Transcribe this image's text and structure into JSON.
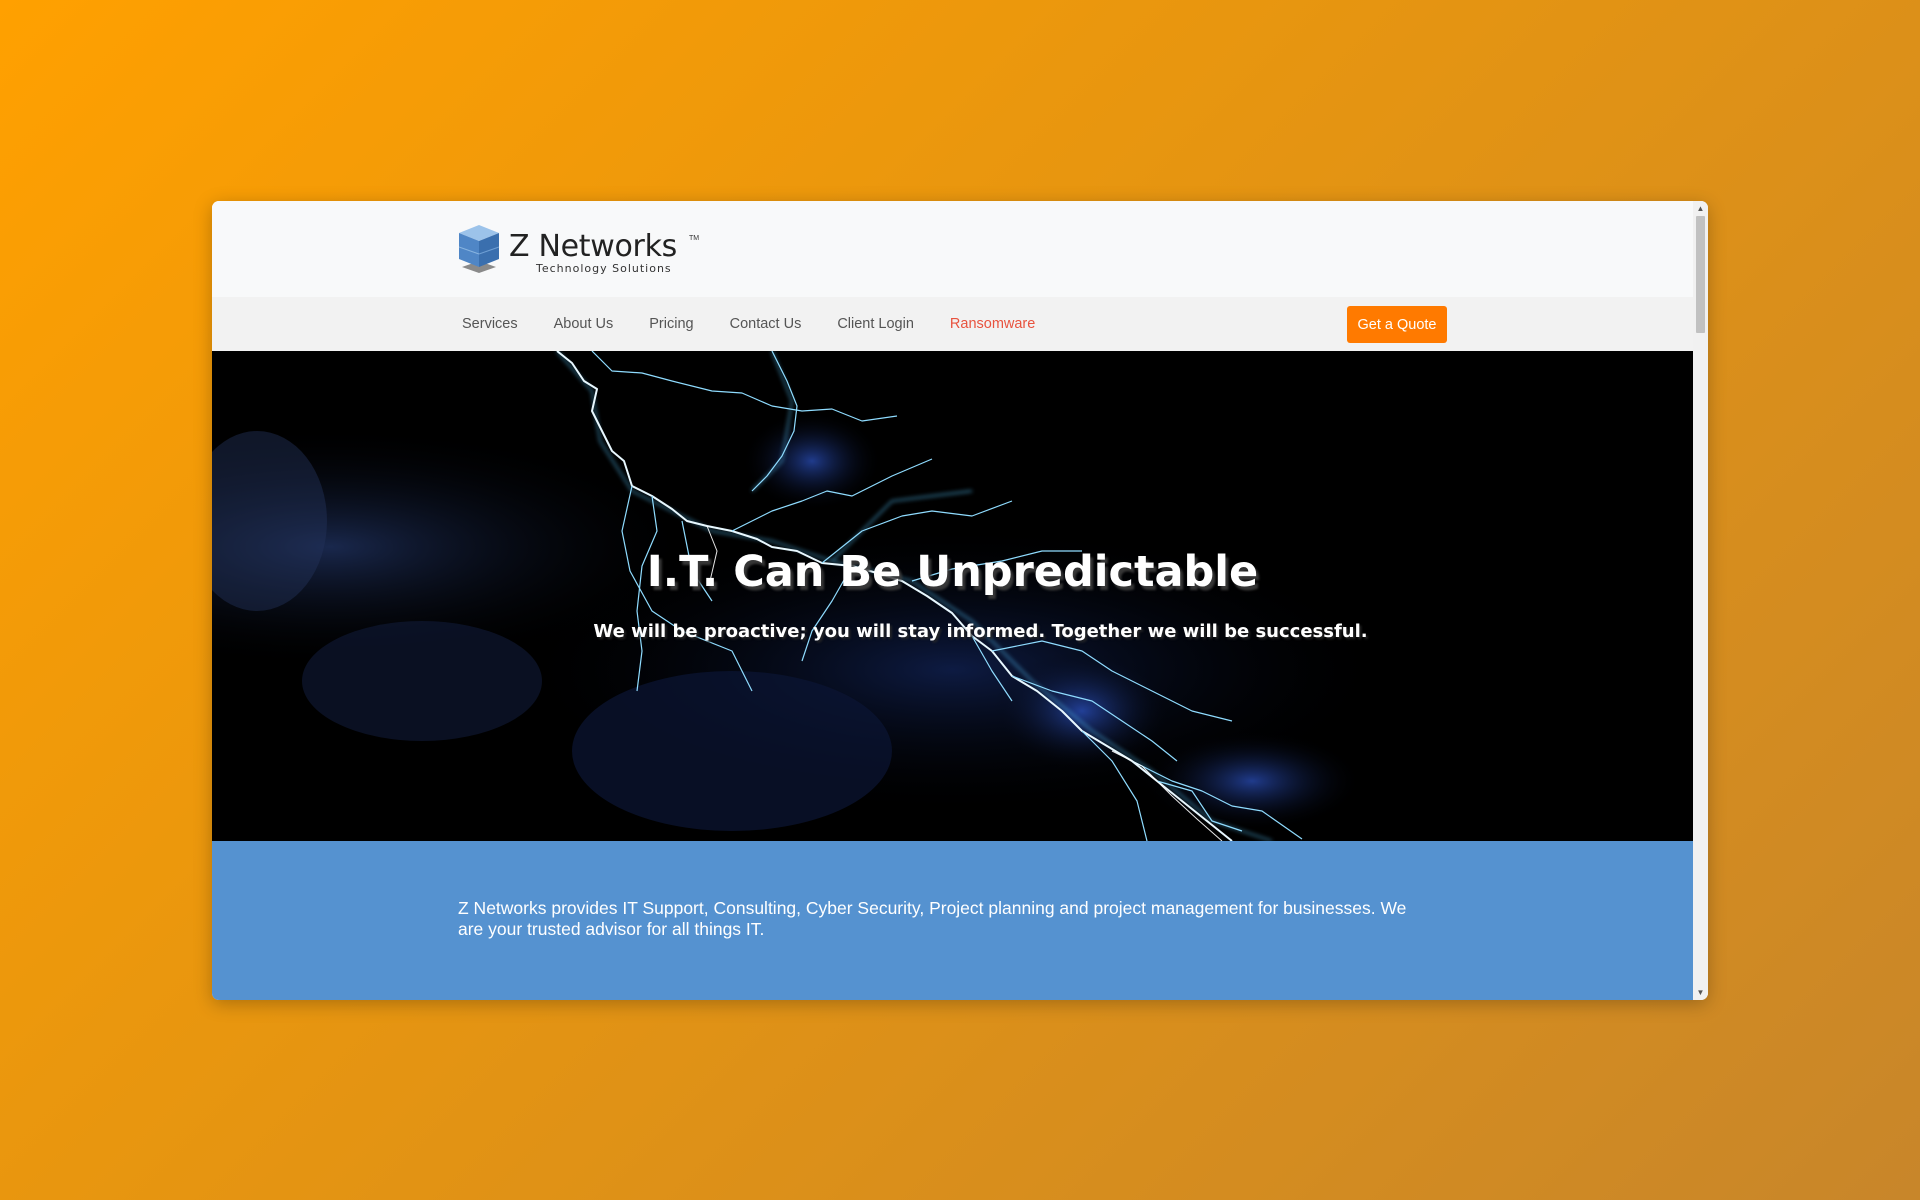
{
  "logo": {
    "name": "Z Networks",
    "trademark": "TM",
    "tagline": "Technology Solutions"
  },
  "nav": {
    "items": [
      {
        "label": "Services"
      },
      {
        "label": "About Us"
      },
      {
        "label": "Pricing"
      },
      {
        "label": "Contact Us"
      },
      {
        "label": "Client Login"
      },
      {
        "label": "Ransomware"
      }
    ],
    "cta_label": "Get a Quote"
  },
  "hero": {
    "title": "I.T. Can Be Unpredictable",
    "subtitle": "We will be proactive; you will stay informed. Together we will be successful."
  },
  "intro": {
    "text": "Z Networks provides IT Support, Consulting, Cyber Security, Project planning and project management for businesses. We are your trusted advisor for all things IT."
  },
  "colors": {
    "page_gradient_start": "#ffa000",
    "page_gradient_end": "#c8862a",
    "cta": "#ff7a00",
    "alert_link": "#e8533f",
    "intro_band": "#5592d0",
    "hero_bg": "#000000"
  },
  "icons": {
    "logo_mark": "blue-cube-icon",
    "scroll_up": "triangle-up-icon",
    "scroll_down": "triangle-down-icon"
  }
}
